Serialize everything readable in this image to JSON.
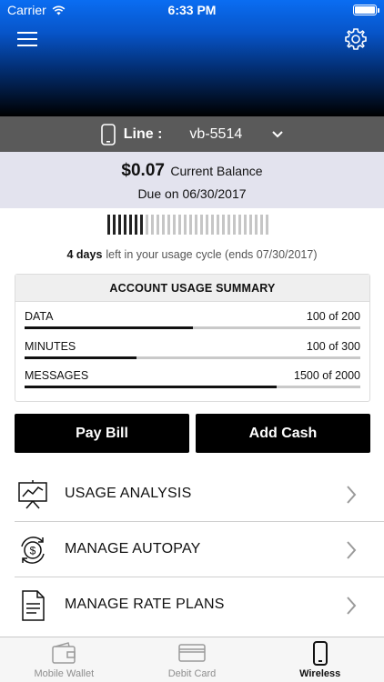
{
  "status": {
    "carrier": "Carrier",
    "time": "6:33 PM"
  },
  "line": {
    "label": "Line :",
    "value": "vb-5514"
  },
  "balance": {
    "amount": "$0.07",
    "label": "Current Balance",
    "due": "Due on 06/30/2017"
  },
  "cycle": {
    "days": "4 days",
    "text": "left in your usage cycle (ends 07/30/2017)",
    "used_segments": 7,
    "total_segments": 30
  },
  "summary": {
    "title": "ACCOUNT USAGE SUMMARY",
    "rows": [
      {
        "name": "DATA",
        "count": "100 of 200",
        "fraction": 0.5
      },
      {
        "name": "MINUTES",
        "count": "100 of 300",
        "fraction": 0.333
      },
      {
        "name": "MESSAGES",
        "count": "1500 of 2000",
        "fraction": 0.75
      }
    ]
  },
  "buttons": {
    "pay": "Pay Bill",
    "add": "Add Cash"
  },
  "menu": [
    {
      "label": "USAGE ANALYSIS",
      "icon": "usage-analysis-icon"
    },
    {
      "label": "MANAGE AUTOPAY",
      "icon": "autopay-icon"
    },
    {
      "label": "MANAGE RATE PLANS",
      "icon": "rate-plans-icon"
    }
  ],
  "tabs": [
    {
      "label": "Mobile Wallet",
      "icon": "wallet-icon"
    },
    {
      "label": "Debit Card",
      "icon": "card-icon"
    },
    {
      "label": "Wireless",
      "icon": "phone-icon",
      "active": true
    }
  ]
}
